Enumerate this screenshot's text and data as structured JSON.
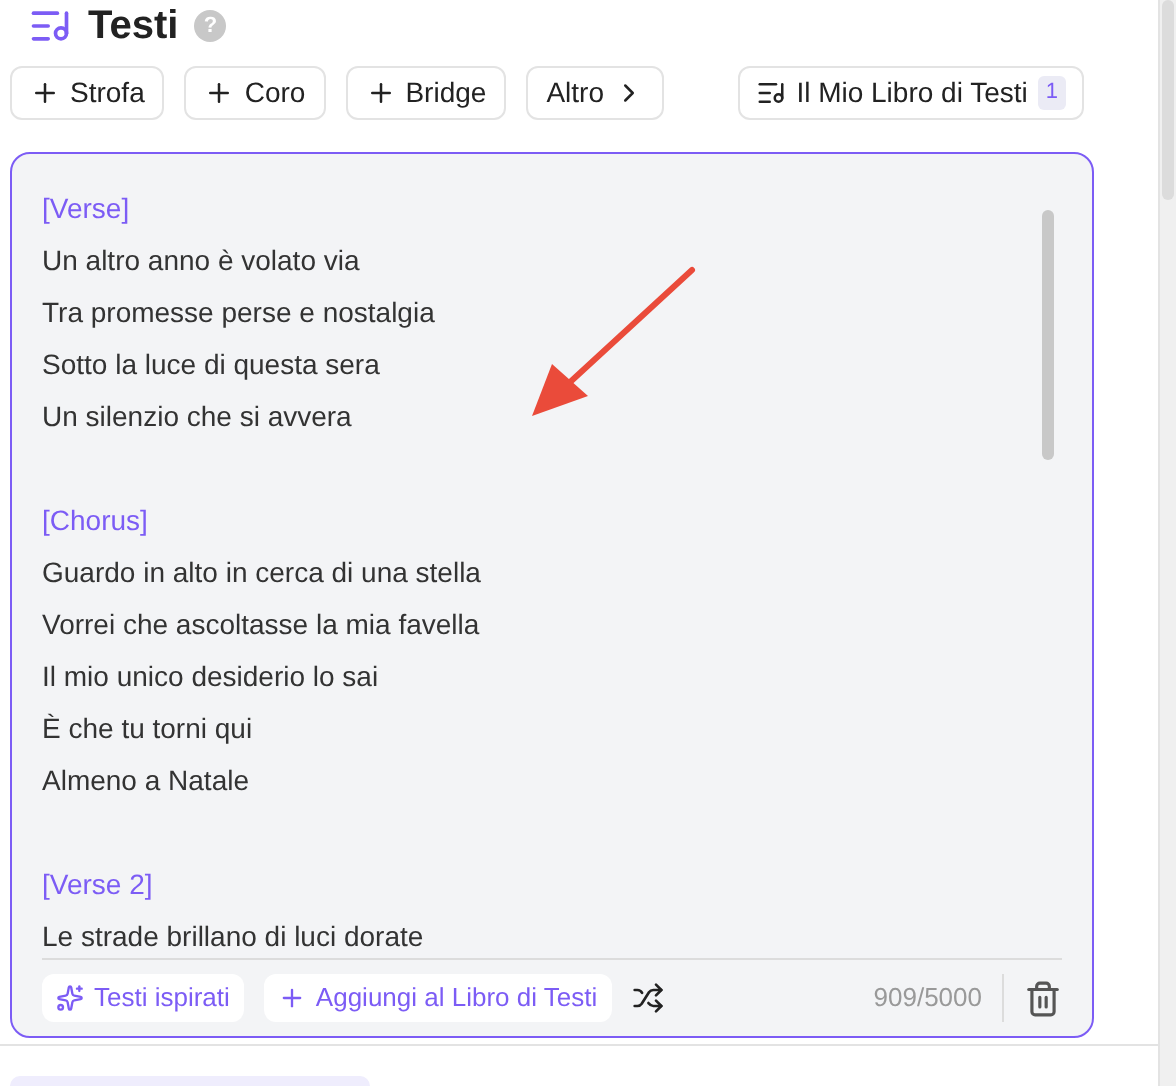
{
  "header": {
    "title": "Testi",
    "help": "?"
  },
  "toolbar": {
    "buttons": [
      {
        "label": "Strofa",
        "kind": "add"
      },
      {
        "label": "Coro",
        "kind": "add"
      },
      {
        "label": "Bridge",
        "kind": "add"
      },
      {
        "label": "Altro",
        "kind": "more"
      }
    ],
    "library": {
      "label": "Il Mio Libro di Testi",
      "count": "1"
    }
  },
  "editor": {
    "sections": [
      {
        "header": "[Verse]",
        "lines": [
          "Un altro anno è volato via",
          "Tra promesse perse e nostalgia",
          "Sotto la luce di questa sera",
          "Un silenzio che si avvera"
        ]
      },
      {
        "header": "[Chorus]",
        "lines": [
          "Guardo in alto in cerca di una stella",
          "Vorrei che ascoltasse la mia favella",
          "Il mio unico desiderio lo sai",
          "È che tu torni qui",
          "Almeno a Natale"
        ]
      },
      {
        "header": "[Verse 2]",
        "lines": [
          "Le strade brillano di luci dorate"
        ]
      }
    ],
    "actions": [
      {
        "label": "Testi ispirati",
        "kind": "sparkle"
      },
      {
        "label": "Aggiungi al Libro di Testi",
        "kind": "add"
      }
    ],
    "counter": "909/5000"
  }
}
